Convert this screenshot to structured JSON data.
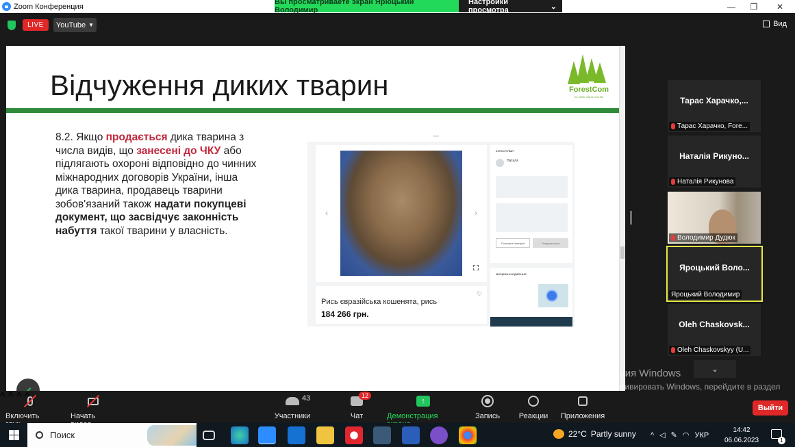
{
  "window": {
    "title": "Zoom Конференция",
    "share_banner": "Вы просматриваете экран Ярюцький Володимир",
    "view_settings": "Настройки просмотра"
  },
  "topbar": {
    "live": "LIVE",
    "stream_target": "YouTube",
    "view": "Вид"
  },
  "slide": {
    "title": "Відчуження диких тварин",
    "logo_text": "ForestCom",
    "logo_sub": "for better nature and life",
    "body_parts": [
      "8.2. Якщо ",
      "продається",
      " дика тварина з числа видів, що ",
      "занесені до ЧКУ",
      " або підлягають охороні відповідно до чинних міжнародних договорів України, інша дика тварина, продавець тварини зобов'язаний також ",
      "надати покупцеві документ, що засвідчує законність набуття",
      " такої тварини у власність."
    ],
    "listing": {
      "title": "Рись євразійська кошенята, рись",
      "price": "184 266 грн.",
      "user": "Наталя",
      "user_section": "КОРИСТУВАЧ",
      "location_section": "МІСЦЕЗНАХОДЖЕННЯ",
      "btn_phone": "Показати телефон",
      "btn_message": "Повідомлення"
    }
  },
  "participants": [
    {
      "tile_name": "Тарас Харачко,...",
      "label": "Тарас Харачко, Fore..."
    },
    {
      "tile_name": "Наталія Рикуно...",
      "label": "Наталія Рикунова"
    },
    {
      "tile_name": "",
      "label": "Володимир Дудюк"
    },
    {
      "tile_name": "Яроцький Воло...",
      "label": "Яроцький Володимир"
    },
    {
      "tile_name": "Oleh Chaskovsk...",
      "label": "Oleh Chaskovskyy (U..."
    }
  ],
  "activation": {
    "line1": "Активация Windows",
    "line2": "Чтобы активировать Windows, перейдите в раздел \"Параметры\"."
  },
  "toolbar": {
    "mic": "Включить звук",
    "video": "Начать видео",
    "participants": "Участники",
    "participants_count": "43",
    "chat": "Чат",
    "chat_badge": "12",
    "share": "Демонстрация экрана",
    "record": "Запись",
    "reactions": "Реакции",
    "apps": "Приложения",
    "leave": "Выйти"
  },
  "taskbar": {
    "search": "Поиск",
    "temperature": "22°C",
    "weather": "Partly sunny",
    "lang": "УКР",
    "time": "14:42",
    "date": "06.06.2023",
    "notifications": "1",
    "colors": {
      "accent": "#2d8cff",
      "share_green": "#23d959",
      "live_red": "#e02828",
      "slide_green": "#2f8a3a"
    }
  }
}
